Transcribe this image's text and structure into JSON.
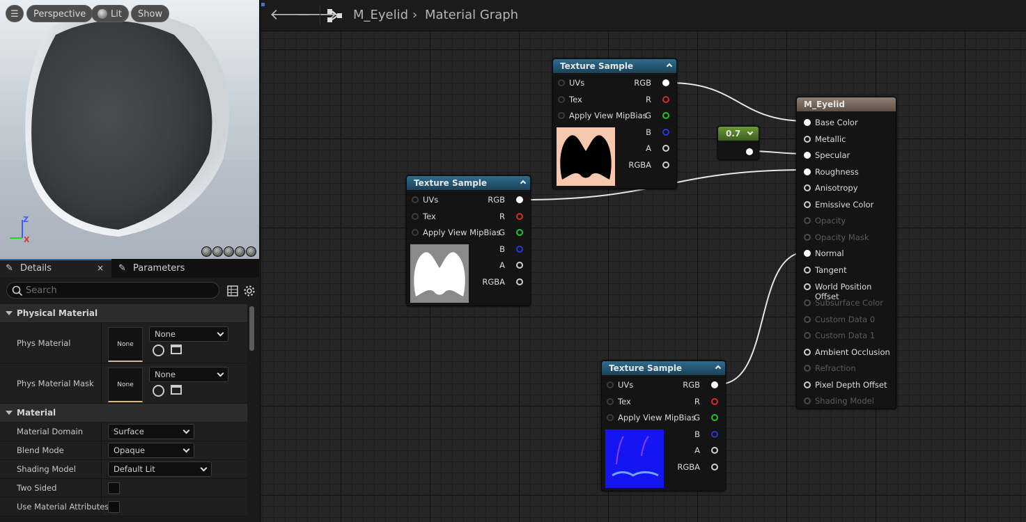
{
  "viewport": {
    "perspective_label": "Perspective",
    "lit_label": "Lit",
    "show_label": "Show",
    "axis_z": "Z",
    "axis_x": "X"
  },
  "details": {
    "tab_details": "Details",
    "tab_parameters": "Parameters",
    "search_placeholder": "Search",
    "categories": {
      "physical_material": "Physical Material",
      "material": "Material"
    },
    "phys_material": {
      "label": "Phys Material",
      "thumb": "None",
      "value": "None"
    },
    "phys_material_mask": {
      "label": "Phys Material Mask",
      "thumb": "None",
      "value": "None"
    },
    "material_domain": {
      "label": "Material Domain",
      "value": "Surface"
    },
    "blend_mode": {
      "label": "Blend Mode",
      "value": "Opaque"
    },
    "shading_model": {
      "label": "Shading Model",
      "value": "Default Lit"
    },
    "two_sided": {
      "label": "Two Sided"
    },
    "use_material_attributes": {
      "label": "Use Material Attributes"
    }
  },
  "graph": {
    "breadcrumb_asset": "M_Eyelid",
    "breadcrumb_graph": "Material Graph",
    "constant_value": "0.7",
    "texture_sample": {
      "title": "Texture Sample",
      "inputs": [
        "UVs",
        "Tex",
        "Apply View MipBias"
      ],
      "outputs": [
        "RGB",
        "R",
        "G",
        "B",
        "A",
        "RGBA"
      ]
    },
    "result_node": {
      "title": "M_Eyelid",
      "pins": [
        {
          "label": "Base Color",
          "state": "connected"
        },
        {
          "label": "Metallic",
          "state": "active"
        },
        {
          "label": "Specular",
          "state": "connected"
        },
        {
          "label": "Roughness",
          "state": "connected"
        },
        {
          "label": "Anisotropy",
          "state": "active"
        },
        {
          "label": "Emissive Color",
          "state": "active"
        },
        {
          "label": "Opacity",
          "state": "disabled"
        },
        {
          "label": "Opacity Mask",
          "state": "disabled"
        },
        {
          "label": "Normal",
          "state": "connected"
        },
        {
          "label": "Tangent",
          "state": "active"
        },
        {
          "label": "World Position Offset",
          "state": "active"
        },
        {
          "label": "Subsurface Color",
          "state": "disabled"
        },
        {
          "label": "Custom Data 0",
          "state": "disabled"
        },
        {
          "label": "Custom Data 1",
          "state": "disabled"
        },
        {
          "label": "Ambient Occlusion",
          "state": "active"
        },
        {
          "label": "Refraction",
          "state": "disabled"
        },
        {
          "label": "Pixel Depth Offset",
          "state": "active"
        },
        {
          "label": "Shading Model",
          "state": "disabled"
        }
      ]
    }
  },
  "colors": {
    "pin_red": "#d42a2a",
    "pin_green": "#22c322",
    "pin_blue": "#2a35e0",
    "texture_header": "#2e6c8e",
    "result_header": "#7a6a5e",
    "constant_header": "#5c8a2e"
  }
}
